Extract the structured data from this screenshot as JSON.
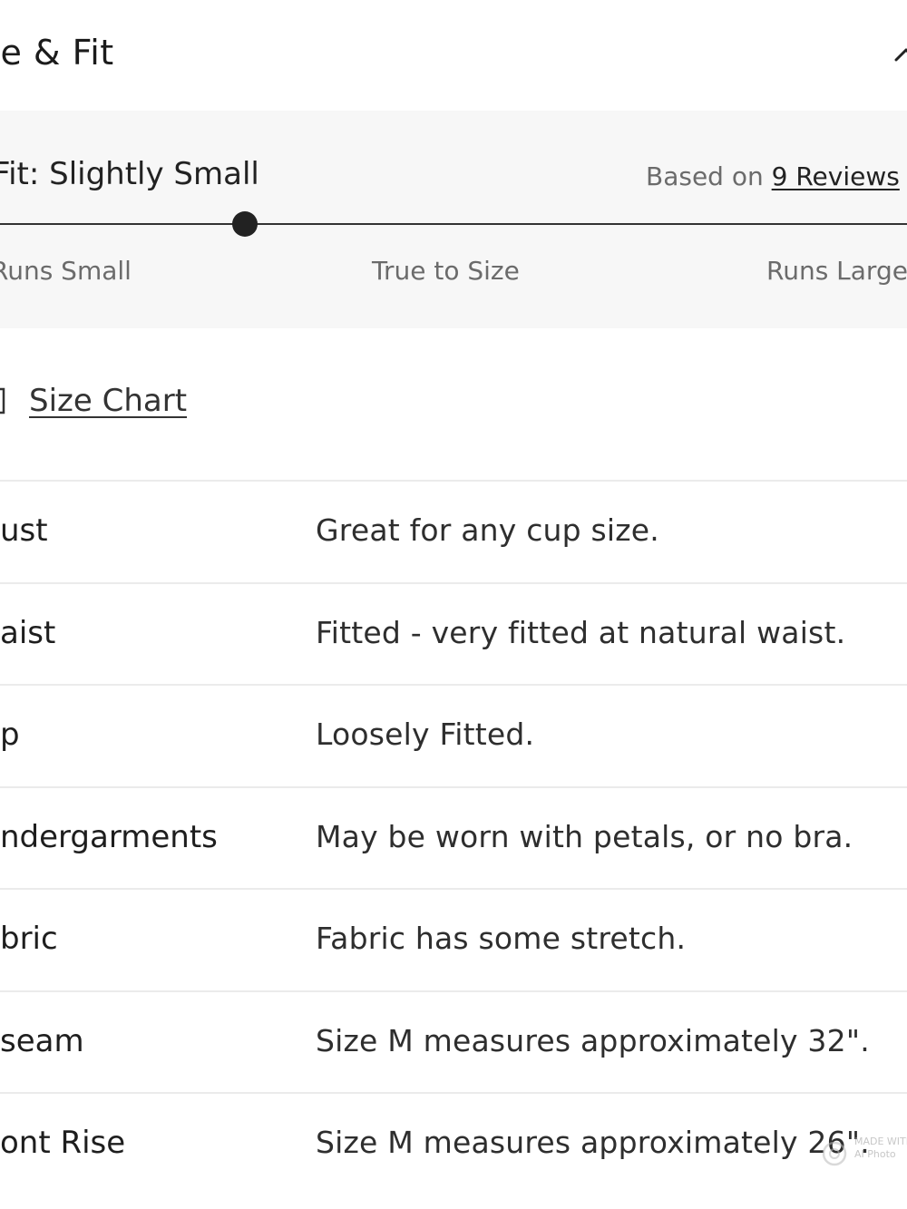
{
  "header": {
    "title": "ze & Fit"
  },
  "fit": {
    "label": "Fit: Slightly Small",
    "reviews_prefix": "Based on",
    "reviews_link": "9 Reviews",
    "position": 0.27,
    "scale_labels": {
      "small": "Runs Small",
      "true": "True to Size",
      "large": "Runs Large"
    }
  },
  "size_chart": {
    "label": "Size Chart"
  },
  "rows": [
    {
      "label": "ust",
      "value": "Great for any cup size."
    },
    {
      "label": "aist",
      "value": "Fitted - very fitted at natural waist."
    },
    {
      "label": "p",
      "value": "Loosely Fitted."
    },
    {
      "label": "ndergarments",
      "value": "May be worn with petals, or no bra."
    },
    {
      "label": "bric",
      "value": "Fabric has some stretch."
    },
    {
      "label": "seam",
      "value": "Size M measures approximately 32\"."
    },
    {
      "label": "ont Rise",
      "value": "Size M measures approximately 26\"."
    }
  ],
  "watermark": {
    "line1": "MADE WITH",
    "line2": "AI Photo"
  },
  "icons": {
    "collapse": "chevron-up-icon",
    "size_chart": "ruler-icon",
    "watermark": "camera-icon"
  }
}
